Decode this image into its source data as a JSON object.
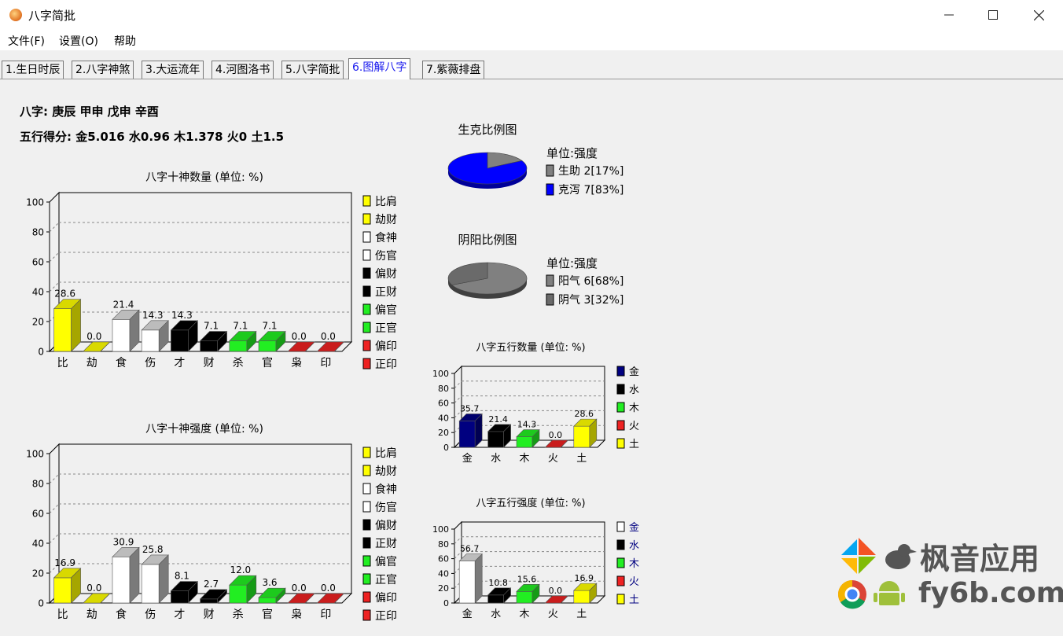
{
  "window": {
    "title": "八字简批",
    "minimize_icon": "minimize-icon",
    "maximize_icon": "maximize-icon",
    "close_icon": "close-icon"
  },
  "menu": [
    "文件(F)",
    "设置(O)",
    "帮助"
  ],
  "tabs": [
    "1.生日时辰",
    "2.八字神煞",
    "3.大运流年",
    "4.河图洛书",
    "5.八字简批",
    "6.图解八字",
    "7.紫薇排盘"
  ],
  "active_tab": 5,
  "bazi_label": "八字:",
  "bazi_value": "庚辰 甲申 戊申 辛酉",
  "wuxing_score_label": "五行得分:",
  "wuxing_score_value": "金5.016 水0.96 木1.378 火0 土1.5",
  "chart_data": [
    {
      "type": "bar",
      "title": "八字十神数量 (单位: %)",
      "categories": [
        "比",
        "劫",
        "食",
        "伤",
        "才",
        "财",
        "杀",
        "官",
        "枭",
        "印"
      ],
      "values": [
        28.6,
        0.0,
        21.4,
        14.3,
        14.3,
        7.1,
        7.1,
        7.1,
        0.0,
        0.0
      ],
      "value_labels": [
        "28.6",
        "0.0",
        "21.4",
        "14.3",
        "14.3",
        "7.1",
        "7.1",
        "7.1",
        "0.0",
        "0.0"
      ],
      "colors": [
        "#ffff00",
        "#ffff00",
        "#ffffff",
        "#ffffff",
        "#000000",
        "#000000",
        "#22ee22",
        "#22ee22",
        "#ee2222",
        "#ee2222"
      ],
      "legend": [
        "比肩",
        "劫财",
        "食神",
        "伤官",
        "偏财",
        "正财",
        "偏官",
        "正官",
        "偏印",
        "正印"
      ],
      "ylim": [
        0,
        100
      ],
      "yticks": [
        "0",
        "20",
        "40",
        "60",
        "80",
        "100"
      ]
    },
    {
      "type": "bar",
      "title": "八字十神强度 (单位: %)",
      "categories": [
        "比",
        "劫",
        "食",
        "伤",
        "才",
        "财",
        "杀",
        "官",
        "枭",
        "印"
      ],
      "values": [
        16.9,
        0.0,
        30.9,
        25.8,
        8.1,
        2.7,
        12.0,
        3.6,
        0.0,
        0.0
      ],
      "value_labels": [
        "16.9",
        "0.0",
        "30.9",
        "25.8",
        "8.1",
        "2.7",
        "12.0",
        "3.6",
        "0.0",
        "0.0"
      ],
      "colors": [
        "#ffff00",
        "#ffff00",
        "#ffffff",
        "#ffffff",
        "#000000",
        "#000000",
        "#22ee22",
        "#22ee22",
        "#ee2222",
        "#ee2222"
      ],
      "legend": [
        "比肩",
        "劫财",
        "食神",
        "伤官",
        "偏财",
        "正财",
        "偏官",
        "正官",
        "偏印",
        "正印"
      ],
      "ylim": [
        0,
        100
      ],
      "yticks": [
        "0",
        "20",
        "40",
        "60",
        "80",
        "100"
      ]
    },
    {
      "type": "pie",
      "title": "生克比例图",
      "unit": "单位:强度",
      "slices": [
        {
          "label": "生助 2[17%]",
          "value": 17,
          "color": "#808080"
        },
        {
          "label": "克泻 7[83%]",
          "value": 83,
          "color": "#0000ff"
        }
      ]
    },
    {
      "type": "pie",
      "title": "阴阳比例图",
      "unit": "单位:强度",
      "slices": [
        {
          "label": "阳气 6[68%]",
          "value": 68,
          "color": "#808080"
        },
        {
          "label": "阴气 3[32%]",
          "value": 32,
          "color": "#6a6a6a"
        }
      ]
    },
    {
      "type": "bar",
      "title": "八字五行数量 (单位: %)",
      "categories": [
        "金",
        "水",
        "木",
        "火",
        "土"
      ],
      "values": [
        35.7,
        21.4,
        14.3,
        0.0,
        28.6
      ],
      "value_labels": [
        "35.7",
        "21.4",
        "14.3",
        "0.0",
        "28.6"
      ],
      "colors": [
        "#000080",
        "#000000",
        "#22ee22",
        "#ee2222",
        "#ffff00"
      ],
      "legend": [
        "金",
        "水",
        "木",
        "火",
        "土"
      ],
      "ylim": [
        0,
        100
      ],
      "yticks": [
        "0",
        "20",
        "40",
        "60",
        "80",
        "100"
      ]
    },
    {
      "type": "bar",
      "title": "八字五行强度 (单位: %)",
      "categories": [
        "金",
        "水",
        "木",
        "火",
        "土"
      ],
      "values": [
        56.7,
        10.8,
        15.6,
        0.0,
        16.9
      ],
      "value_labels": [
        "56.7",
        "10.8",
        "15.6",
        "0.0",
        "16.9"
      ],
      "colors": [
        "#ffffff",
        "#000000",
        "#22ee22",
        "#ee2222",
        "#ffff00"
      ],
      "legend": [
        "金",
        "水",
        "木",
        "火",
        "土"
      ],
      "legend_text_color": "#000080",
      "ylim": [
        0,
        100
      ],
      "yticks": [
        "0",
        "20",
        "40",
        "60",
        "80",
        "100"
      ]
    }
  ],
  "watermark": {
    "line1": "枫音应用",
    "line2": "fy6b.com"
  }
}
